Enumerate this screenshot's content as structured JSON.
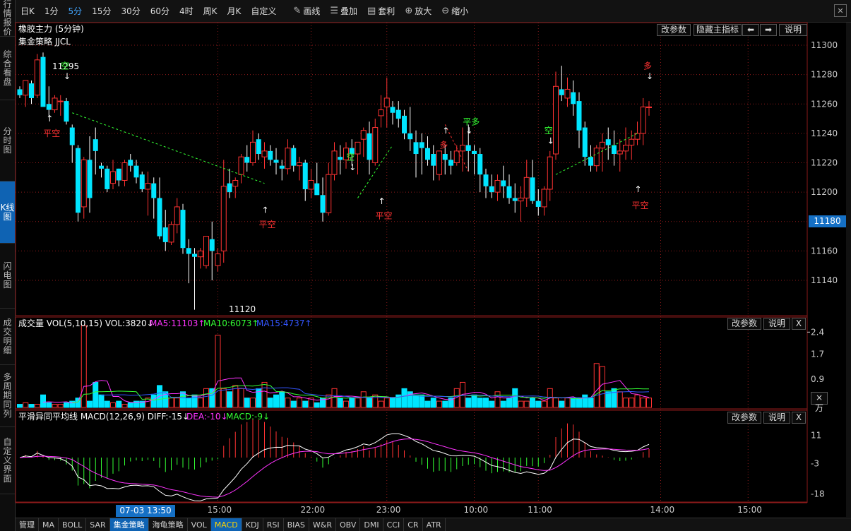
{
  "side_tabs": [
    "行情报价",
    "综合看盘",
    "分时图",
    "K线图",
    "闪电图",
    "成交明细",
    "多周期同列",
    "自定义界面"
  ],
  "side_active": 3,
  "periods": [
    "日K",
    "1分",
    "5分",
    "15分",
    "30分",
    "60分",
    "4时",
    "周K",
    "月K",
    "自定义"
  ],
  "period_active": 2,
  "tools": [
    {
      "icon": "pencil-icon",
      "glyph": "✎",
      "label": "画线"
    },
    {
      "icon": "layers-icon",
      "glyph": "☰",
      "label": "叠加"
    },
    {
      "icon": "arbitrage-icon",
      "glyph": "▤",
      "label": "套利"
    },
    {
      "icon": "zoom-in-icon",
      "glyph": "⊕",
      "label": "放大"
    },
    {
      "icon": "zoom-out-icon",
      "glyph": "⊖",
      "label": "缩小"
    }
  ],
  "main": {
    "title": "橡胶主力 (5分钟)",
    "strategy": "集金策略 JJCL",
    "btn_params": "改参数",
    "btn_hide": "隐藏主指标",
    "btn_help": "说明",
    "arrow_left": "⬅",
    "arrow_right": "➡",
    "current_price": "11180"
  },
  "vol": {
    "title": "成交量 VOL(5,10,15) VOL:3820↓",
    "ma5": "MA5:11103↑",
    "ma10": "MA10:6073↑",
    "ma15": "MA15:4737↑",
    "btn_params": "改参数",
    "btn_help": "说明",
    "btn_close": "X",
    "unit": "×万"
  },
  "macd": {
    "title": "平滑异同平均线 MACD(12,26,9) DIFF:-15↓",
    "dea": "DEA:-10↓",
    "macd": "MACD:-9↓",
    "btn_params": "改参数",
    "btn_help": "说明",
    "btn_close": "X"
  },
  "cursor_time": "07-03 13:50",
  "bottom_tabs": [
    "管理",
    "MA",
    "BOLL",
    "SAR",
    "集金策略",
    "海龟策略",
    "VOL",
    "MACD",
    "KDJ",
    "RSI",
    "BIAS",
    "W&R",
    "OBV",
    "DMI",
    "CCI",
    "CR",
    "ATR"
  ],
  "bottom_active": [
    4,
    7
  ],
  "colors": {
    "up": "#ff3232",
    "down": "#00e5ff",
    "ma5": "#ff33ff",
    "ma10": "#33ff33",
    "ma15": "#3355ff",
    "label_green": "#33ff33",
    "label_red": "#ff3232",
    "grid": "#8b1a1a"
  },
  "chart_data": {
    "type": "candlestick",
    "title": "橡胶主力 (5分钟)",
    "y_ticks": [
      11140,
      11160,
      11180,
      11200,
      11220,
      11240,
      11260,
      11280,
      11300
    ],
    "time_labels": [
      {
        "label": "15:00",
        "i": 34
      },
      {
        "label": "22:00",
        "i": 50
      },
      {
        "label": "23:00",
        "i": 63
      },
      {
        "label": "10:00",
        "i": 78
      },
      {
        "label": "11:00",
        "i": 89
      },
      {
        "label": "14:00",
        "i": 110
      },
      {
        "label": "15:00",
        "i": 125
      }
    ],
    "candles": [
      [
        11270,
        11272,
        11264,
        11266
      ],
      [
        11266,
        11276,
        11258,
        11276
      ],
      [
        11274,
        11276,
        11260,
        11264
      ],
      [
        11266,
        11294,
        11264,
        11290
      ],
      [
        11292,
        11295,
        11262,
        11258
      ],
      [
        11260,
        11272,
        11252,
        11256
      ],
      [
        11256,
        11266,
        11254,
        11264
      ],
      [
        11262,
        11266,
        11252,
        11262
      ],
      [
        11262,
        11264,
        11246,
        11248
      ],
      [
        11244,
        11246,
        11220,
        11232
      ],
      [
        11230,
        11232,
        11180,
        11186
      ],
      [
        11190,
        11224,
        11182,
        11222
      ],
      [
        11222,
        11238,
        11186,
        11196
      ],
      [
        11236,
        11244,
        11212,
        11228
      ],
      [
        11218,
        11220,
        11210,
        11216
      ],
      [
        11216,
        11218,
        11200,
        11202
      ],
      [
        11206,
        11222,
        11202,
        11214
      ],
      [
        11216,
        11216,
        11204,
        11208
      ],
      [
        11208,
        11222,
        11204,
        11220
      ],
      [
        11222,
        11226,
        11214,
        11218
      ],
      [
        11218,
        11222,
        11206,
        11210
      ],
      [
        11212,
        11214,
        11200,
        11202
      ],
      [
        11202,
        11214,
        11184,
        11206
      ],
      [
        11206,
        11210,
        11182,
        11196
      ],
      [
        11196,
        11210,
        11168,
        11170
      ],
      [
        11176,
        11188,
        11160,
        11166
      ],
      [
        11166,
        11180,
        11164,
        11178
      ],
      [
        11178,
        11196,
        11172,
        11190
      ],
      [
        11188,
        11192,
        11158,
        11162
      ],
      [
        11162,
        11168,
        11138,
        11158
      ],
      [
        11158,
        11162,
        11120,
        11156
      ],
      [
        11156,
        11162,
        11148,
        11160
      ],
      [
        11150,
        11170,
        11148,
        11170
      ],
      [
        11168,
        11180,
        11140,
        11160
      ],
      [
        11150,
        11162,
        11146,
        11158
      ],
      [
        11160,
        11222,
        11152,
        11204
      ],
      [
        11206,
        11216,
        11196,
        11200
      ],
      [
        11204,
        11210,
        11196,
        11208
      ],
      [
        11212,
        11226,
        11206,
        11224
      ],
      [
        11224,
        11232,
        11214,
        11220
      ],
      [
        11220,
        11242,
        11218,
        11234
      ],
      [
        11236,
        11240,
        11222,
        11226
      ],
      [
        11224,
        11234,
        11216,
        11228
      ],
      [
        11228,
        11232,
        11218,
        11222
      ],
      [
        11222,
        11230,
        11212,
        11220
      ],
      [
        11218,
        11222,
        11208,
        11216
      ],
      [
        11216,
        11236,
        11212,
        11230
      ],
      [
        11230,
        11232,
        11214,
        11218
      ],
      [
        11218,
        11224,
        11208,
        11220
      ],
      [
        11220,
        11222,
        11194,
        11202
      ],
      [
        11202,
        11216,
        11196,
        11208
      ],
      [
        11206,
        11220,
        11200,
        11198
      ],
      [
        11198,
        11210,
        11180,
        11186
      ],
      [
        11186,
        11220,
        11184,
        11212
      ],
      [
        11212,
        11234,
        11208,
        11228
      ],
      [
        11224,
        11232,
        11212,
        11222
      ],
      [
        11222,
        11234,
        11216,
        11230
      ],
      [
        11230,
        11236,
        11218,
        11226
      ],
      [
        11226,
        11232,
        11212,
        11234
      ],
      [
        11236,
        11244,
        11224,
        11242
      ],
      [
        11240,
        11248,
        11212,
        11222
      ],
      [
        11220,
        11250,
        11218,
        11244
      ],
      [
        11252,
        11266,
        11244,
        11256
      ],
      [
        11258,
        11278,
        11244,
        11264
      ],
      [
        11258,
        11262,
        11246,
        11254
      ],
      [
        11256,
        11262,
        11244,
        11250
      ],
      [
        11252,
        11256,
        11236,
        11240
      ],
      [
        11240,
        11258,
        11228,
        11236
      ],
      [
        11234,
        11242,
        11210,
        11226
      ],
      [
        11234,
        11240,
        11212,
        11230
      ],
      [
        11230,
        11238,
        11218,
        11222
      ],
      [
        11226,
        11232,
        11208,
        11218
      ],
      [
        11212,
        11222,
        11208,
        11228
      ],
      [
        11226,
        11232,
        11212,
        11222
      ],
      [
        11222,
        11228,
        11212,
        11218
      ],
      [
        11220,
        11232,
        11218,
        11228
      ],
      [
        11228,
        11244,
        11214,
        11232
      ],
      [
        11232,
        11246,
        11214,
        11228
      ],
      [
        11228,
        11232,
        11212,
        11226
      ],
      [
        11226,
        11230,
        11200,
        11212
      ],
      [
        11212,
        11216,
        11196,
        11204
      ],
      [
        11204,
        11212,
        11196,
        11200
      ],
      [
        11200,
        11212,
        11194,
        11208
      ],
      [
        11208,
        11218,
        11196,
        11204
      ],
      [
        11204,
        11212,
        11192,
        11196
      ],
      [
        11196,
        11206,
        11186,
        11194
      ],
      [
        11194,
        11204,
        11180,
        11196
      ],
      [
        11196,
        11222,
        11190,
        11210
      ],
      [
        11210,
        11222,
        11192,
        11194
      ],
      [
        11194,
        11202,
        11184,
        11190
      ],
      [
        11190,
        11204,
        11184,
        11202
      ],
      [
        11202,
        11228,
        11194,
        11224
      ],
      [
        11226,
        11282,
        11222,
        11272
      ],
      [
        11270,
        11286,
        11262,
        11266
      ],
      [
        11264,
        11278,
        11258,
        11270
      ],
      [
        11268,
        11276,
        11252,
        11260
      ],
      [
        11262,
        11268,
        11230,
        11242
      ],
      [
        11244,
        11248,
        11218,
        11224
      ],
      [
        11224,
        11232,
        11214,
        11218
      ],
      [
        11218,
        11232,
        11214,
        11230
      ],
      [
        11230,
        11240,
        11214,
        11234
      ],
      [
        11236,
        11244,
        11222,
        11232
      ],
      [
        11232,
        11242,
        11218,
        11226
      ],
      [
        11226,
        11236,
        11214,
        11228
      ],
      [
        11228,
        11244,
        11222,
        11232
      ],
      [
        11232,
        11242,
        11222,
        11236
      ],
      [
        11236,
        11248,
        11232,
        11240
      ],
      [
        11240,
        11264,
        11232,
        11258
      ],
      [
        11258,
        11262,
        11252,
        11258
      ]
    ],
    "volume_max": 2.7,
    "volume_ticks": [
      2.4,
      1.7,
      0.9
    ],
    "macd_ticks": [
      11,
      -3,
      -18
    ],
    "annotations": [
      {
        "text": "11295",
        "type": "price"
      },
      {
        "text": "11120",
        "type": "price"
      },
      {
        "text": "空",
        "color": "green"
      },
      {
        "text": "平空",
        "color": "red"
      },
      {
        "text": "多",
        "color": "red"
      },
      {
        "text": "平多",
        "color": "green"
      }
    ]
  }
}
